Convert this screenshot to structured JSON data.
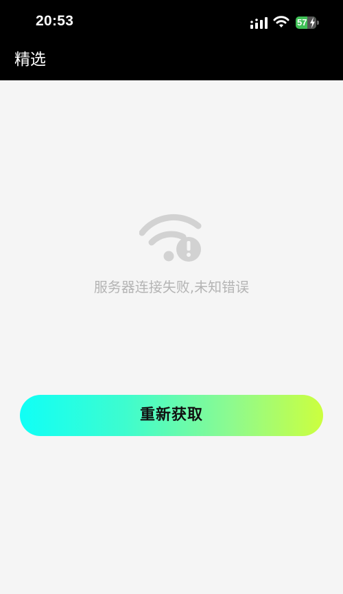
{
  "status_bar": {
    "time": "20:53",
    "battery_level": "57",
    "battery_fraction": 0.57,
    "signal_icon": "cellular-signal-icon",
    "wifi_icon": "wifi-icon",
    "charging_icon": "lightning-bolt-icon"
  },
  "nav": {
    "title": "精选"
  },
  "error": {
    "icon": "wifi-error-icon",
    "message": "服务器连接失败,未知错误"
  },
  "retry": {
    "label": "重新获取"
  },
  "colors": {
    "header_bg": "#000000",
    "page_bg": "#f5f5f5",
    "battery_green": "#3fc056",
    "error_icon_gray": "#d2d2d2",
    "error_text_gray": "#b4b4b4",
    "button_gradient_start": "#10fff6",
    "button_gradient_end": "#ccff3e"
  }
}
